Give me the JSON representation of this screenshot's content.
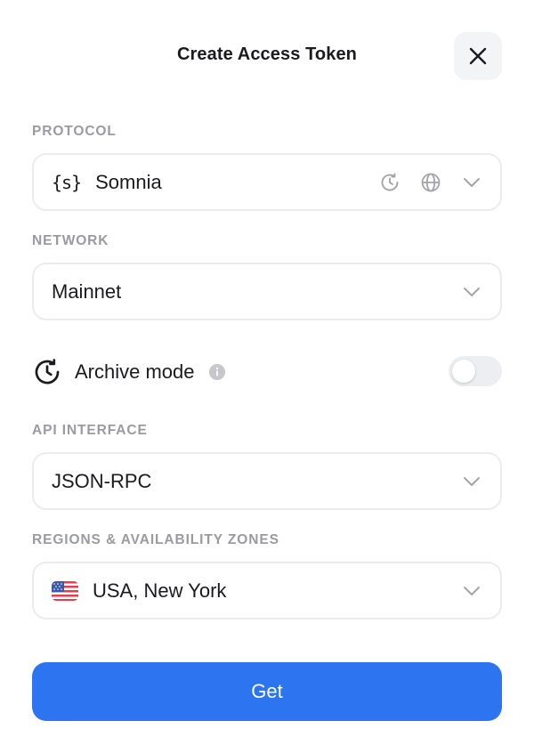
{
  "modal": {
    "title": "Create Access Token",
    "close_icon": "close-icon"
  },
  "protocol": {
    "label": "PROTOCOL",
    "icon_text": "{s}",
    "value": "Somnia",
    "trail_icons": [
      "archive-clock-icon",
      "globe-icon",
      "chevron-down-icon"
    ]
  },
  "network": {
    "label": "NETWORK",
    "value": "Mainnet"
  },
  "archive": {
    "label": "Archive mode",
    "enabled": false
  },
  "api_interface": {
    "label": "API INTERFACE",
    "value": "JSON-RPC"
  },
  "region": {
    "label": "REGIONS & AVAILABILITY ZONES",
    "flag_icon": "us-flag-icon",
    "value": "USA, New York"
  },
  "submit": {
    "label": "Get"
  },
  "colors": {
    "accent": "#2d74f0",
    "label_gray": "#9a9aa2",
    "border": "#ececef"
  }
}
